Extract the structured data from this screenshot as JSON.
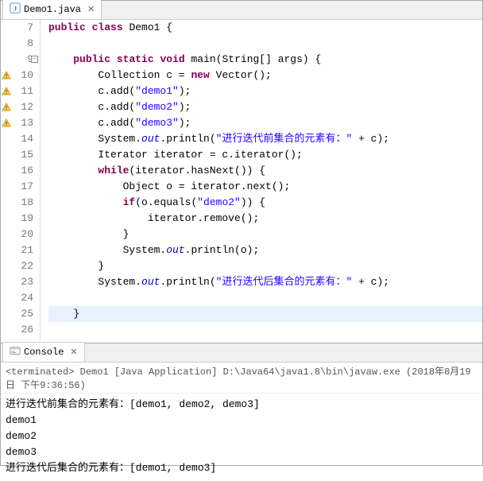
{
  "editor": {
    "tab": {
      "filename": "Demo1.java"
    },
    "lines": [
      {
        "num": 7,
        "marker": "",
        "fold": "",
        "tokens": [
          [
            "kw",
            "public"
          ],
          [
            "txt",
            " "
          ],
          [
            "kw",
            "class"
          ],
          [
            "txt",
            " Demo1 {"
          ]
        ]
      },
      {
        "num": 8,
        "marker": "",
        "fold": "",
        "tokens": [
          [
            "txt",
            ""
          ]
        ]
      },
      {
        "num": 9,
        "marker": "",
        "fold": "⊖",
        "tokens": [
          [
            "txt",
            "    "
          ],
          [
            "kw",
            "public"
          ],
          [
            "txt",
            " "
          ],
          [
            "kw",
            "static"
          ],
          [
            "txt",
            " "
          ],
          [
            "kw",
            "void"
          ],
          [
            "txt",
            " main(String[] args) {"
          ]
        ]
      },
      {
        "num": 10,
        "marker": "warn",
        "fold": "",
        "tokens": [
          [
            "txt",
            "        Collection c = "
          ],
          [
            "kw",
            "new"
          ],
          [
            "txt",
            " Vector();"
          ]
        ]
      },
      {
        "num": 11,
        "marker": "warn",
        "fold": "",
        "tokens": [
          [
            "txt",
            "        c.add("
          ],
          [
            "str",
            "\"demo1\""
          ],
          [
            "txt",
            ");"
          ]
        ]
      },
      {
        "num": 12,
        "marker": "warn",
        "fold": "",
        "tokens": [
          [
            "txt",
            "        c.add("
          ],
          [
            "str",
            "\"demo2\""
          ],
          [
            "txt",
            ");"
          ]
        ]
      },
      {
        "num": 13,
        "marker": "warn",
        "fold": "",
        "tokens": [
          [
            "txt",
            "        c.add("
          ],
          [
            "str",
            "\"demo3\""
          ],
          [
            "txt",
            ");"
          ]
        ]
      },
      {
        "num": 14,
        "marker": "",
        "fold": "",
        "tokens": [
          [
            "txt",
            "        System."
          ],
          [
            "fld",
            "out"
          ],
          [
            "txt",
            ".println("
          ],
          [
            "str",
            "\"进行迭代前集合的元素有：\""
          ],
          [
            "txt",
            " + c);"
          ]
        ]
      },
      {
        "num": 15,
        "marker": "",
        "fold": "",
        "tokens": [
          [
            "txt",
            "        Iterator iterator = c.iterator();"
          ]
        ]
      },
      {
        "num": 16,
        "marker": "",
        "fold": "",
        "tokens": [
          [
            "txt",
            "        "
          ],
          [
            "kw",
            "while"
          ],
          [
            "txt",
            "(iterator.hasNext()) {"
          ]
        ]
      },
      {
        "num": 17,
        "marker": "",
        "fold": "",
        "tokens": [
          [
            "txt",
            "            Object o = iterator.next();"
          ]
        ]
      },
      {
        "num": 18,
        "marker": "",
        "fold": "",
        "tokens": [
          [
            "txt",
            "            "
          ],
          [
            "kw",
            "if"
          ],
          [
            "txt",
            "(o.equals("
          ],
          [
            "str",
            "\"demo2\""
          ],
          [
            "txt",
            ")) {"
          ]
        ]
      },
      {
        "num": 19,
        "marker": "",
        "fold": "",
        "tokens": [
          [
            "txt",
            "                iterator.remove();"
          ]
        ]
      },
      {
        "num": 20,
        "marker": "",
        "fold": "",
        "tokens": [
          [
            "txt",
            "            }"
          ]
        ]
      },
      {
        "num": 21,
        "marker": "",
        "fold": "",
        "tokens": [
          [
            "txt",
            "            System."
          ],
          [
            "fld",
            "out"
          ],
          [
            "txt",
            ".println(o);"
          ]
        ]
      },
      {
        "num": 22,
        "marker": "",
        "fold": "",
        "tokens": [
          [
            "txt",
            "        }"
          ]
        ]
      },
      {
        "num": 23,
        "marker": "",
        "fold": "",
        "tokens": [
          [
            "txt",
            "        System."
          ],
          [
            "fld",
            "out"
          ],
          [
            "txt",
            ".println("
          ],
          [
            "str",
            "\"进行迭代后集合的元素有：\""
          ],
          [
            "txt",
            " + c);"
          ]
        ]
      },
      {
        "num": 24,
        "marker": "",
        "fold": "",
        "tokens": [
          [
            "txt",
            ""
          ]
        ]
      },
      {
        "num": 25,
        "marker": "",
        "fold": "",
        "hl": true,
        "tokens": [
          [
            "txt",
            "    }"
          ]
        ]
      },
      {
        "num": 26,
        "marker": "",
        "fold": "",
        "tokens": [
          [
            "txt",
            ""
          ]
        ]
      }
    ]
  },
  "console": {
    "tab_label": "Console",
    "header": "<terminated> Demo1 [Java Application] D:\\Java64\\java1.8\\bin\\javaw.exe (2018年8月19日 下午9:36:56)",
    "output": [
      "进行迭代前集合的元素有：[demo1, demo2, demo3]",
      "demo1",
      "demo2",
      "demo3",
      "进行迭代后集合的元素有：[demo1, demo3]"
    ]
  }
}
